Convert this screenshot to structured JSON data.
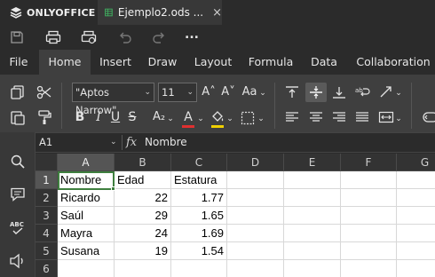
{
  "app": {
    "name": "ONLYOFFICE",
    "doc_title": "Ejemplo2.ods ...",
    "close": "×"
  },
  "quick": {
    "more": "..."
  },
  "tabs": [
    "File",
    "Home",
    "Insert",
    "Draw",
    "Layout",
    "Formula",
    "Data",
    "Collaboration"
  ],
  "toolbar": {
    "font_name": "\"Aptos Narrow\"",
    "font_size": "11",
    "grow_font": "A˄",
    "shrink_font": "A˅",
    "change_case": "Aa",
    "bold": "B",
    "italic": "I",
    "underline": "U",
    "strike": "S",
    "subscript": "A₂",
    "font_color_letter": "A",
    "font_color": "#e03030",
    "fill_color": "#f0d000"
  },
  "formula_bar": {
    "cell_ref": "A1",
    "fx": "fx",
    "value": "Nombre"
  },
  "sheet": {
    "columns": [
      "A",
      "B",
      "C",
      "D",
      "E",
      "F",
      "G"
    ],
    "rows": [
      "1",
      "2",
      "3",
      "4",
      "5",
      "6"
    ],
    "cells": [
      [
        "Nombre",
        "Edad",
        "Estatura"
      ],
      [
        "Ricardo",
        "22",
        "1.77"
      ],
      [
        "Saúl",
        "29",
        "1.65"
      ],
      [
        "Mayra",
        "24",
        "1.69"
      ],
      [
        "Susana",
        "19",
        "1.54"
      ]
    ]
  },
  "colors": {
    "accent_selection": "#3f7f3f",
    "ui_dark": "#2b2b2b",
    "toolbar": "#3f3f3f"
  }
}
